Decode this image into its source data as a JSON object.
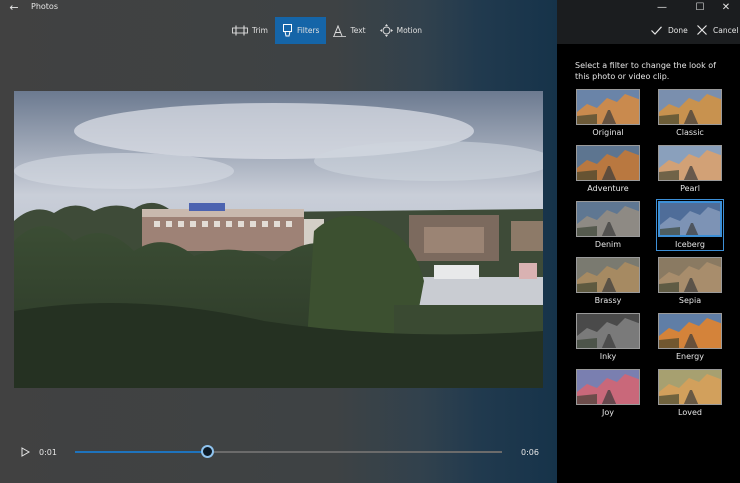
{
  "window": {
    "title": "Photos",
    "back_glyph": "←",
    "minimize_glyph": "—",
    "maximize_glyph": "☐",
    "close_glyph": "✕"
  },
  "toolbar": {
    "tabs": [
      {
        "label": "Trim",
        "icon": "trim-icon"
      },
      {
        "label": "Filters",
        "icon": "filters-icon",
        "active": true
      },
      {
        "label": "Text",
        "icon": "text-icon"
      },
      {
        "label": "Motion",
        "icon": "motion-icon"
      }
    ],
    "done_label": "Done",
    "cancel_label": "Cancel"
  },
  "playback": {
    "current_time": "0:01",
    "end_time": "0:06",
    "progress": 0.31
  },
  "filters_panel": {
    "instruction": "Select a filter to change the look of this photo or video clip.",
    "filters": [
      {
        "label": "Original"
      },
      {
        "label": "Classic"
      },
      {
        "label": "Adventure"
      },
      {
        "label": "Pearl"
      },
      {
        "label": "Denim"
      },
      {
        "label": "Iceberg",
        "selected": true
      },
      {
        "label": "Brassy"
      },
      {
        "label": "Sepia"
      },
      {
        "label": "Inky"
      },
      {
        "label": "Energy"
      },
      {
        "label": "Joy"
      },
      {
        "label": "Loved"
      }
    ]
  },
  "colors": {
    "accent": "#1565a8",
    "selection": "#3d8fd6",
    "panel_bg": "#000000"
  }
}
